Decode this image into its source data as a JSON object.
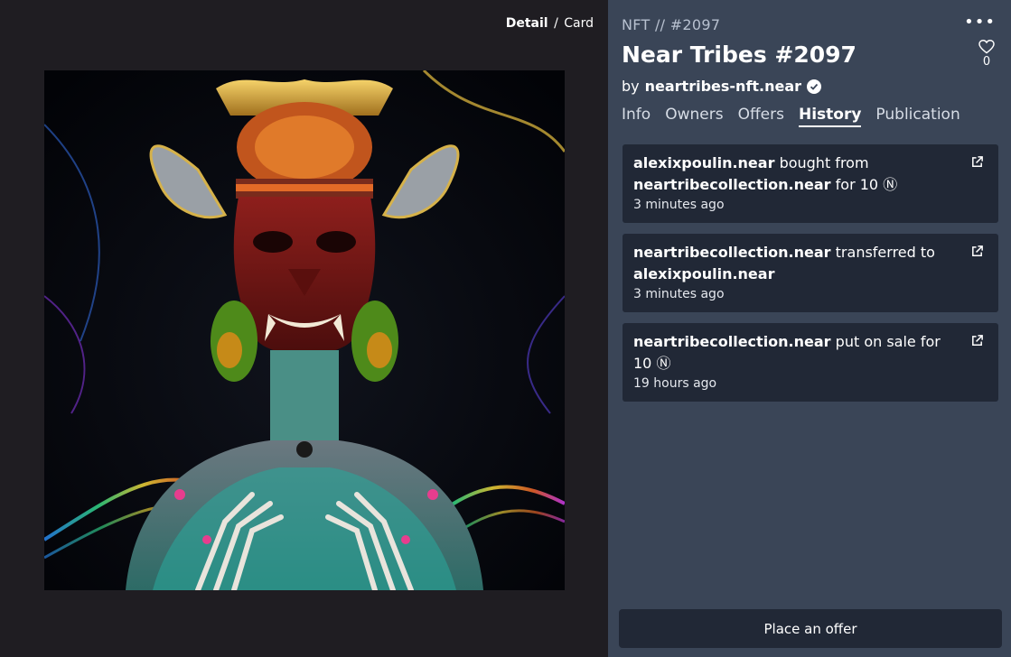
{
  "view_toggle": {
    "detail": "Detail",
    "separator": "/",
    "card": "Card"
  },
  "header": {
    "nft_id": "NFT // #2097",
    "more_label": "•••",
    "like_count": "0",
    "title": "Near Tribes #2097",
    "by_prefix": "by",
    "creator": "neartribes-nft.near"
  },
  "tabs": [
    {
      "label": "Info",
      "active": false
    },
    {
      "label": "Owners",
      "active": false
    },
    {
      "label": "Offers",
      "active": false
    },
    {
      "label": "History",
      "active": true
    },
    {
      "label": "Publication",
      "active": false
    }
  ],
  "history": [
    {
      "actor": "alexixpoulin.near",
      "action": "bought from",
      "target": "neartribecollection.near",
      "suffix": "for 10",
      "currency_symbol": "Ⓝ",
      "time": "3 minutes ago"
    },
    {
      "actor": "neartribecollection.near",
      "action": "transferred to",
      "target": "alexixpoulin.near",
      "suffix": "",
      "currency_symbol": "",
      "time": "3 minutes ago"
    },
    {
      "actor": "neartribecollection.near",
      "action": "put on sale for 10",
      "target": "",
      "suffix": "",
      "currency_symbol": "Ⓝ",
      "time": "19 hours ago"
    }
  ],
  "offer_button": {
    "label": "Place an offer"
  },
  "icons": {
    "more": "more-dots-icon",
    "like": "heart-icon",
    "verified": "verified-badge-icon",
    "external": "external-link-icon"
  },
  "colors": {
    "left_bg": "#1f1d22",
    "right_bg": "#3a4557",
    "card_bg": "#212836",
    "muted_text": "#b7c0cf"
  }
}
